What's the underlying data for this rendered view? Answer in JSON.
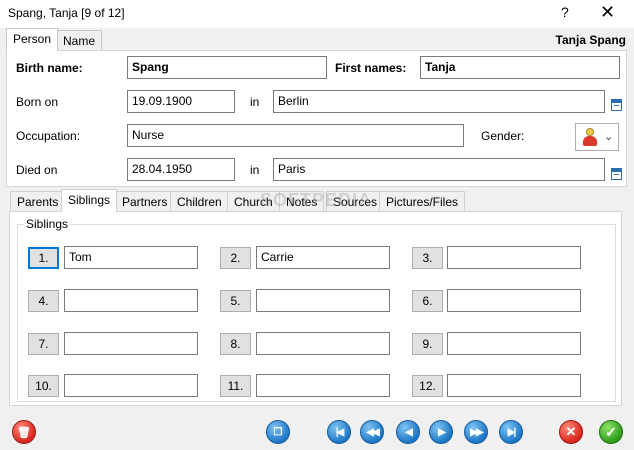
{
  "window": {
    "title": "Spang, Tanja [9 of 12]",
    "help_label": "?",
    "close_label": "✕"
  },
  "top_tabs": [
    {
      "label": "Person",
      "active": true
    },
    {
      "label": "Name",
      "active": false
    }
  ],
  "person_header": "Tanja Spang",
  "person": {
    "birth_name_label": "Birth name:",
    "birth_name": "Spang",
    "first_names_label": "First names:",
    "first_names": "Tanja",
    "born_label": "Born on",
    "born_date": "19.09.1900",
    "born_in_label": "in",
    "born_place": "Berlin",
    "occupation_label": "Occupation:",
    "occupation": "Nurse",
    "gender_label": "Gender:",
    "gender_icon": "female-icon",
    "died_label": "Died on",
    "died_date": "28.04.1950",
    "died_in_label": "in",
    "died_place": "Paris"
  },
  "lower_tabs": [
    {
      "label": "Parents",
      "active": false
    },
    {
      "label": "Siblings",
      "active": true
    },
    {
      "label": "Partners",
      "active": false
    },
    {
      "label": "Children",
      "active": false
    },
    {
      "label": "Church",
      "active": false
    },
    {
      "label": "Notes",
      "active": false
    },
    {
      "label": "Sources",
      "active": false
    },
    {
      "label": "Pictures/Files",
      "active": false
    }
  ],
  "siblings": {
    "caption": "Siblings",
    "slots": [
      {
        "num": "1.",
        "value": "Tom"
      },
      {
        "num": "2.",
        "value": "Carrie"
      },
      {
        "num": "3.",
        "value": ""
      },
      {
        "num": "4.",
        "value": ""
      },
      {
        "num": "5.",
        "value": ""
      },
      {
        "num": "6.",
        "value": ""
      },
      {
        "num": "7.",
        "value": ""
      },
      {
        "num": "8.",
        "value": ""
      },
      {
        "num": "9.",
        "value": ""
      },
      {
        "num": "10.",
        "value": ""
      },
      {
        "num": "11.",
        "value": ""
      },
      {
        "num": "12.",
        "value": ""
      }
    ]
  },
  "watermark": "SOFTPEDIA",
  "toolbar": {
    "delete_icon": "trash-icon",
    "copy_icon": "copy-icon",
    "first_icon": "first-record-icon",
    "rewind_icon": "rewind-icon",
    "prev_icon": "previous-icon",
    "next_icon": "next-icon",
    "forward_icon": "fast-forward-icon",
    "last_icon": "last-record-icon",
    "cancel_icon": "cancel-icon",
    "ok_icon": "ok-icon"
  },
  "colors": {
    "accent": "#0078d7",
    "nav_blue": "#1d77c7",
    "danger_red": "#d9261c",
    "ok_green": "#2e9c1a"
  }
}
